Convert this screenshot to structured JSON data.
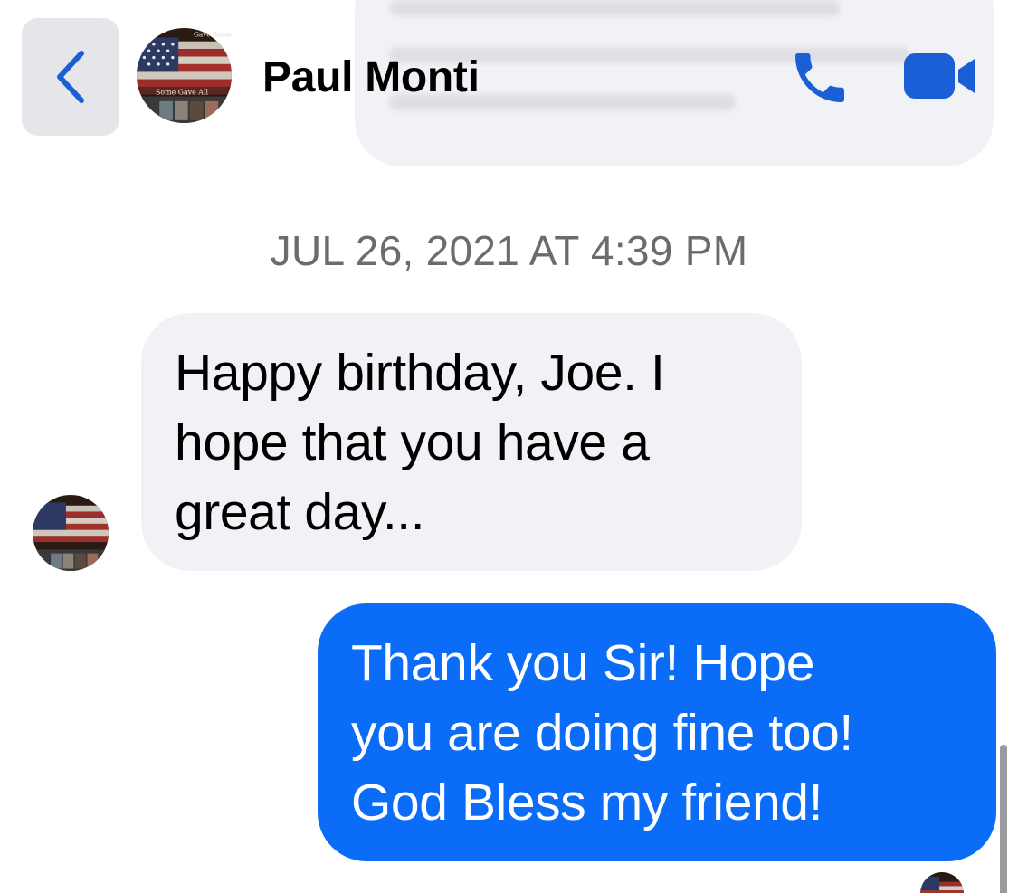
{
  "header": {
    "contact_name": "Paul Monti",
    "back_icon": "chevron-left-icon",
    "call_icon": "phone-icon",
    "video_icon": "video-camera-icon",
    "avatar_text_top": "Gave Some",
    "avatar_text_bottom": "Some Gave All"
  },
  "thread": {
    "timestamp": "JUL 26, 2021 AT 4:39 PM",
    "messages": [
      {
        "direction": "incoming",
        "lines": [
          "Happy birthday, Joe. I",
          "hope that you have a",
          "great day..."
        ]
      },
      {
        "direction": "outgoing",
        "lines": [
          "Thank you Sir! Hope",
          "you are doing fine too!",
          "God Bless my friend!"
        ]
      }
    ]
  },
  "colors": {
    "accent": "#0b6cf8",
    "icon_blue": "#1a5fd6",
    "incoming_bubble": "#f1f2f6",
    "timestamp_gray": "#6c6c70",
    "back_button_bg": "#e6e6ea"
  }
}
